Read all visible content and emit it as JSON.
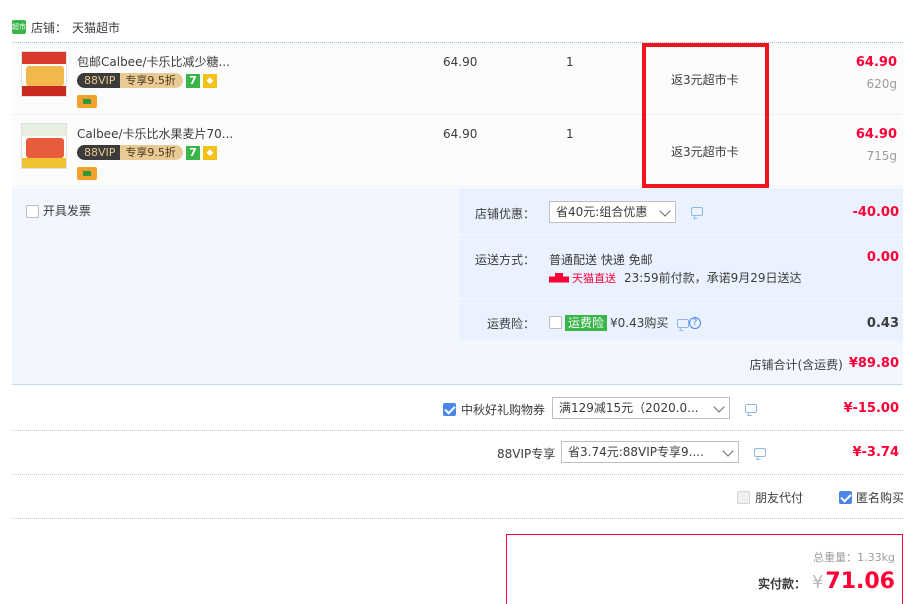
{
  "store": {
    "badge": "超市",
    "label": "店铺：",
    "name": "天猫超市"
  },
  "items": [
    {
      "title": "包邮Calbee/卡乐比减少糖...",
      "vip_left": "88VIP",
      "vip_right": "专享9.5折",
      "tag7": "7",
      "price": "64.90",
      "qty": "1",
      "rebate": "返3元超市卡",
      "amount": "64.90",
      "weight": "620g"
    },
    {
      "title": "Calbee/卡乐比水果麦片70...",
      "vip_left": "88VIP",
      "vip_right": "专享9.5折",
      "tag7": "7",
      "price": "64.90",
      "qty": "1",
      "rebate": "返3元超市卡",
      "amount": "64.90",
      "weight": "715g"
    }
  ],
  "invoice": {
    "label": "开具发票"
  },
  "shop_discount": {
    "label": "店铺优惠：",
    "selected": "省40元:组合优惠",
    "value": "-40.00"
  },
  "shipping": {
    "label": "运送方式：",
    "method": "普通配送 快递 免邮",
    "tmall_label": "天猫直送",
    "promise": "23:59前付款，承诺9月29日送达",
    "value": "0.00"
  },
  "insurance": {
    "label": "运费险：",
    "tag": "运费险",
    "price": "¥0.43购买",
    "help": "?",
    "value": "0.43"
  },
  "store_total": {
    "label": "店铺合计(含运费)",
    "value": "¥89.80"
  },
  "coupon": {
    "label": "中秋好礼购物券",
    "selected": "满129减15元（2020.0...",
    "value": "¥-15.00"
  },
  "vip": {
    "label": "88VIP专享",
    "selected": "省3.74元:88VIP专享9....",
    "value": "¥-3.74"
  },
  "options": {
    "friend_pay": "朋友代付",
    "anonymous": "匿名购买"
  },
  "summary": {
    "weight_label": "总重量：",
    "weight": "1.33kg",
    "pay_label": "实付款：",
    "currency": "¥",
    "total": "71.06"
  }
}
